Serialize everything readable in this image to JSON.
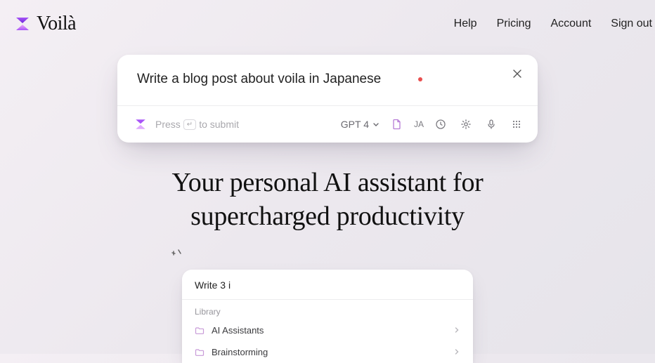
{
  "brand": {
    "name": "Voilà"
  },
  "nav": {
    "help": "Help",
    "pricing": "Pricing",
    "account": "Account",
    "signout": "Sign out"
  },
  "prompt": {
    "text": "Write a blog post about voila in Japanese",
    "model": "GPT 4",
    "lang_badge": "JA",
    "hint_prefix": "Press",
    "hint_key": "↵",
    "hint_suffix": "to submit"
  },
  "hero": {
    "line1": "Your personal AI assistant for",
    "line2": "supercharged productivity"
  },
  "library": {
    "input_value": "Write 3 i",
    "section_label": "Library",
    "items": [
      {
        "label": "AI Assistants"
      },
      {
        "label": "Brainstorming"
      }
    ]
  }
}
